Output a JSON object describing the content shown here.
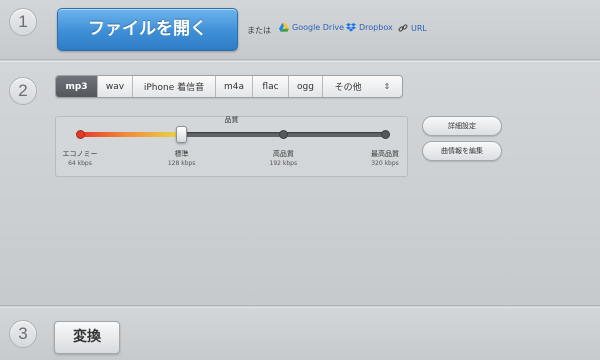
{
  "steps": {
    "one": "1",
    "two": "2",
    "three": "3"
  },
  "open": {
    "button_label": "ファイルを開く",
    "or_text": "または",
    "sources": [
      {
        "label": "Google Drive",
        "icon": "google-drive-icon"
      },
      {
        "label": "Dropbox",
        "icon": "dropbox-icon"
      },
      {
        "label": "URL",
        "icon": "link-icon"
      }
    ]
  },
  "formats": {
    "items": [
      "mp3",
      "wav",
      "iPhone 着信音",
      "m4a",
      "flac",
      "ogg",
      "その他"
    ],
    "selected": "mp3"
  },
  "quality": {
    "title": "品質",
    "selected_level": 1,
    "levels": [
      {
        "label": "エコノミー",
        "rate": "64 kbps"
      },
      {
        "label": "標準",
        "rate": "128 kbps"
      },
      {
        "label": "高品質",
        "rate": "192 kbps"
      },
      {
        "label": "最高品質",
        "rate": "320 kbps"
      }
    ]
  },
  "side": {
    "advanced_label": "詳細設定",
    "edit_info_label": "曲情報を編集"
  },
  "convert": {
    "button_label": "変換"
  },
  "colors": {
    "primary_button": "#3f8fd6",
    "active_format": "#5c6166",
    "link": "#2a62b5",
    "quality_low": "#e33a2c"
  }
}
